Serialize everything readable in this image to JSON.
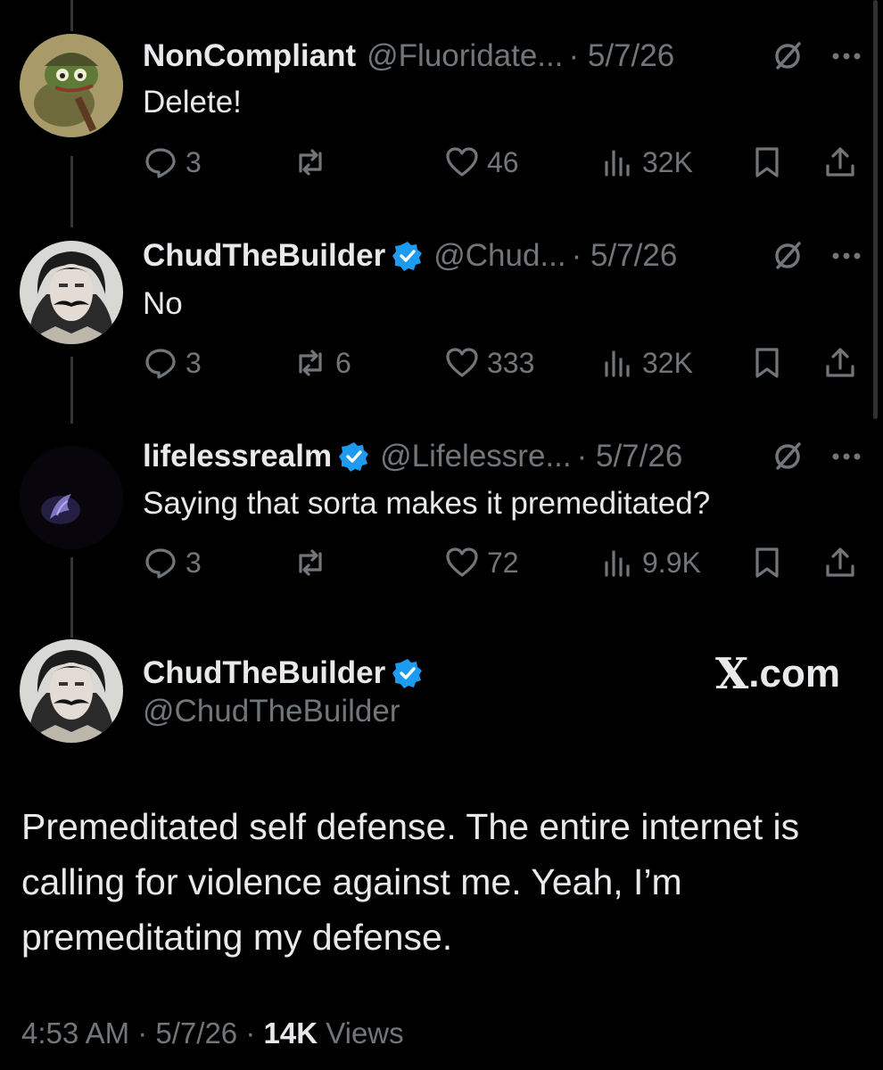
{
  "replies": [
    {
      "name": "NonCompliant",
      "verified": false,
      "handle": "@Fluoridate...",
      "date": "· 5/7/26",
      "text": "Delete!",
      "stats": {
        "replies": "3",
        "reposts": "",
        "likes": "46",
        "views": "32K"
      }
    },
    {
      "name": "ChudTheBuilder",
      "verified": true,
      "handle": "@Chud...",
      "date": "· 5/7/26",
      "text": "No",
      "stats": {
        "replies": "3",
        "reposts": "6",
        "likes": "333",
        "views": "32K"
      }
    },
    {
      "name": "lifelessrealm",
      "verified": true,
      "handle": "@Lifelessre...",
      "date": "· 5/7/26",
      "text": "Saying that sorta makes it premeditated?",
      "stats": {
        "replies": "3",
        "reposts": "",
        "likes": "72",
        "views": "9.9K"
      }
    }
  ],
  "main": {
    "name": "ChudTheBuilder",
    "handle": "@ChudTheBuilder",
    "site": ".com",
    "site_mark": "X",
    "text": "Premeditated self defense. The entire internet is calling for violence against me. Yeah, I’m premeditating my defense.",
    "time": "4:53 AM · 5/7/26 · ",
    "views_count": "14K",
    "views_label": " Views"
  },
  "colors": {
    "background": "#000000",
    "text": "#e7e9ea",
    "muted": "#71767b",
    "verified": "#1d9bf0"
  },
  "icons": [
    "reply-icon",
    "repost-icon",
    "like-icon",
    "views-icon",
    "bookmark-icon",
    "share-icon",
    "grok-icon",
    "more-icon",
    "verified-badge-icon"
  ]
}
